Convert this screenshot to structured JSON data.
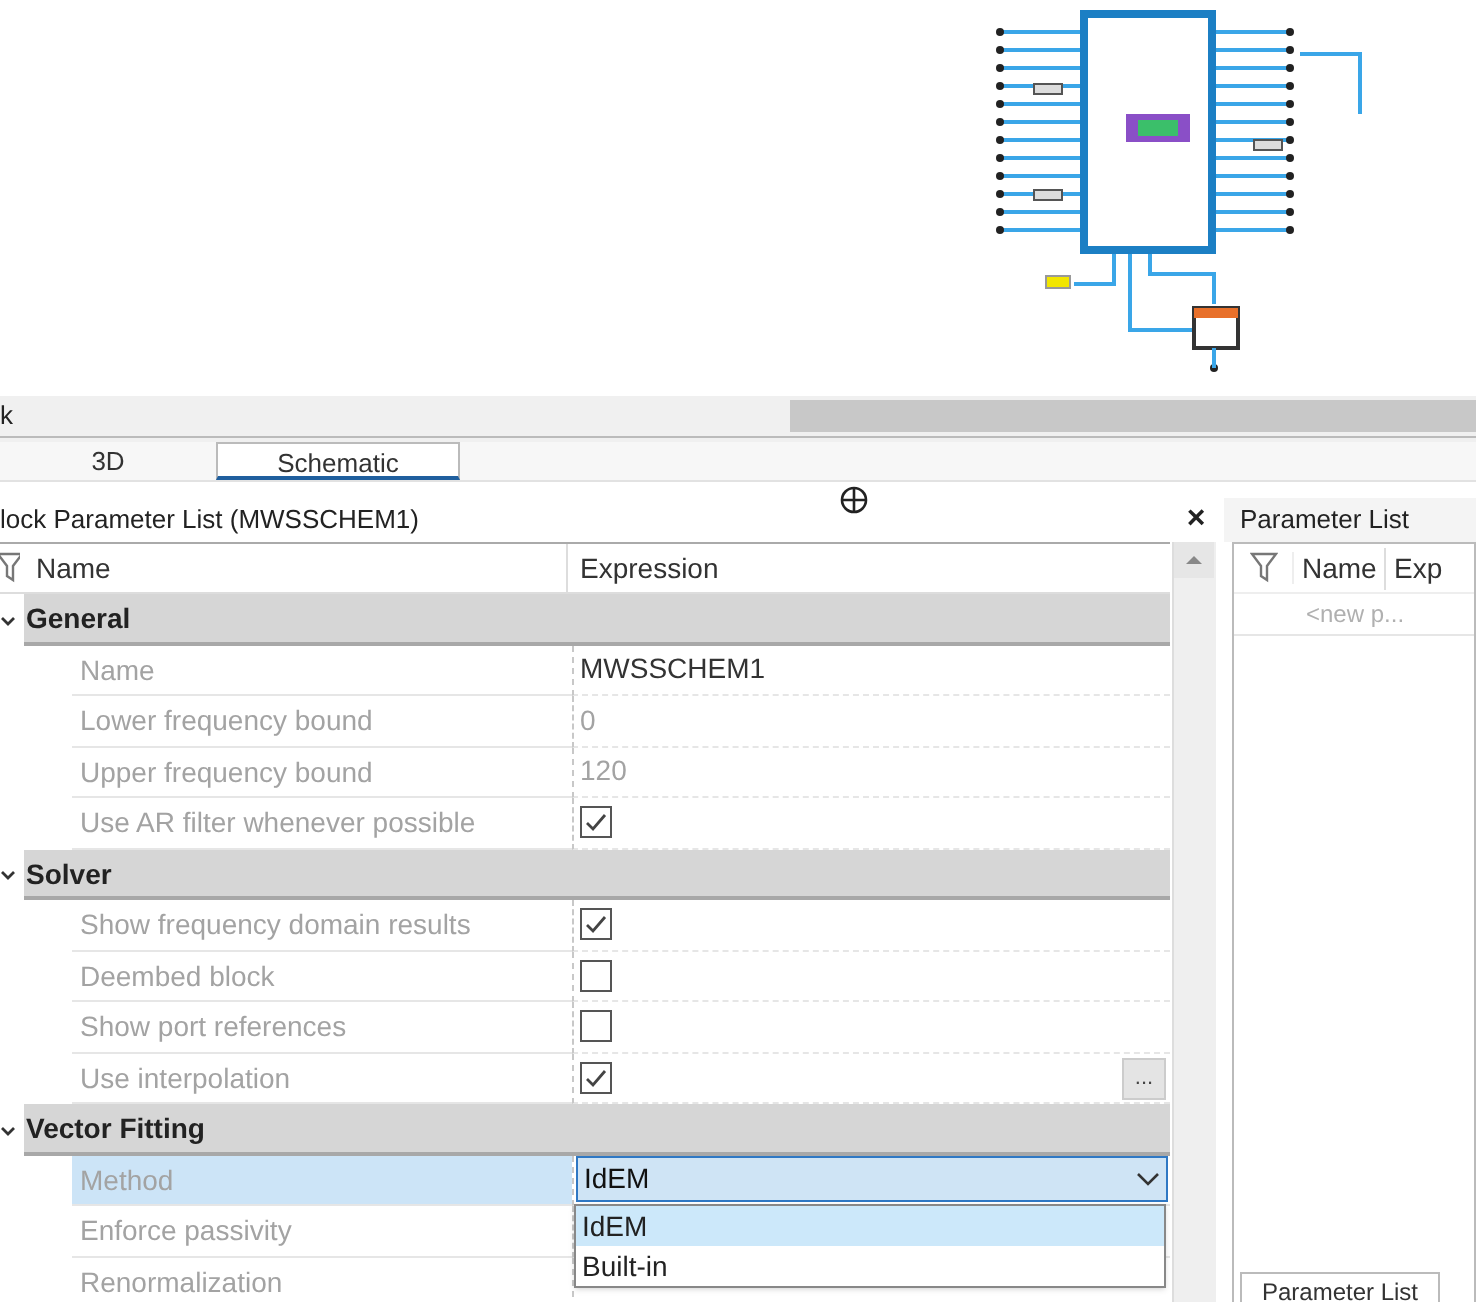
{
  "top_bar": {
    "title": "k"
  },
  "view_tabs": [
    {
      "label": "3D",
      "selected": false
    },
    {
      "label": "Schematic",
      "selected": true
    }
  ],
  "block_panel": {
    "title": "lock Parameter List (MWSSCHEM1)",
    "close": "×",
    "columns": [
      "Name",
      "Expression"
    ],
    "groups": [
      {
        "title": "General",
        "expanded": true,
        "rows": [
          {
            "kind": "text",
            "name": "Name",
            "value": "MWSSCHEM1",
            "disabled": false
          },
          {
            "kind": "text",
            "name": "Lower frequency bound",
            "value": "0",
            "disabled": true
          },
          {
            "kind": "text",
            "name": "Upper frequency bound",
            "value": "120",
            "disabled": true
          },
          {
            "kind": "check",
            "name": "Use AR filter whenever possible",
            "checked": true
          }
        ]
      },
      {
        "title": "Solver",
        "expanded": true,
        "rows": [
          {
            "kind": "check",
            "name": "Show frequency domain results",
            "checked": true
          },
          {
            "kind": "check",
            "name": "Deembed block",
            "checked": false
          },
          {
            "kind": "check",
            "name": "Show port references",
            "checked": false
          },
          {
            "kind": "check",
            "name": "Use interpolation",
            "checked": true,
            "button": "..."
          }
        ]
      },
      {
        "title": "Vector Fitting",
        "expanded": true,
        "rows": [
          {
            "kind": "combo",
            "name": "Method",
            "value": "IdEM",
            "selected": true,
            "open": true,
            "options": [
              {
                "label": "IdEM",
                "selected": true
              },
              {
                "label": "Built-in",
                "selected": false
              }
            ]
          },
          {
            "kind": "text",
            "name": "Enforce passivity"
          },
          {
            "kind": "text",
            "name": "Renormalization"
          }
        ]
      }
    ]
  },
  "parameter_panel": {
    "title": "Parameter List",
    "columns": [
      "Name",
      "Exp"
    ],
    "new_row": "<new p...",
    "bottom_tab": "Parameter List"
  }
}
